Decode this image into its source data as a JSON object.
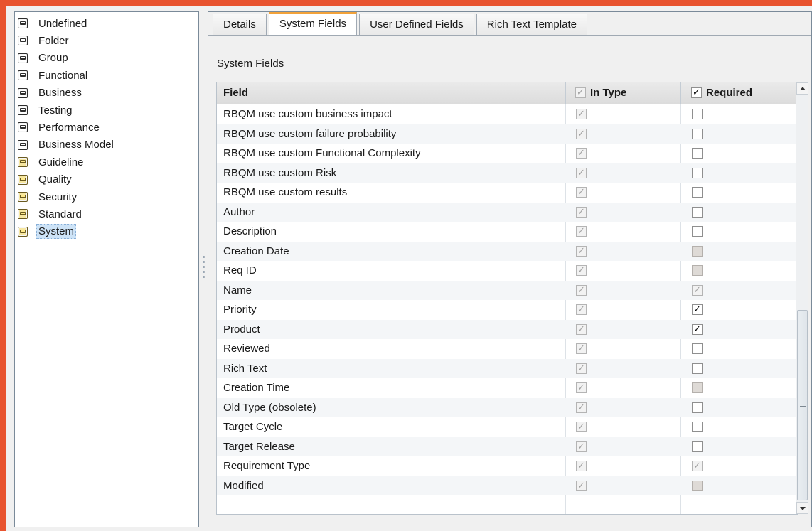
{
  "tree": {
    "items": [
      {
        "label": "Undefined",
        "icon": "req-type-icon"
      },
      {
        "label": "Folder",
        "icon": "req-type-icon"
      },
      {
        "label": "Group",
        "icon": "req-type-icon"
      },
      {
        "label": "Functional",
        "icon": "req-type-icon"
      },
      {
        "label": "Business",
        "icon": "req-type-icon"
      },
      {
        "label": "Testing",
        "icon": "req-type-icon"
      },
      {
        "label": "Performance",
        "icon": "req-type-icon"
      },
      {
        "label": "Business Model",
        "icon": "req-type-icon"
      },
      {
        "label": "Guideline",
        "icon": "req-type-yellow-icon"
      },
      {
        "label": "Quality",
        "icon": "req-type-yellow-icon"
      },
      {
        "label": "Security",
        "icon": "req-type-yellow-icon"
      },
      {
        "label": "Standard",
        "icon": "req-type-yellow-icon"
      },
      {
        "label": "System",
        "icon": "req-type-yellow-icon",
        "selected": true
      }
    ]
  },
  "tabs": [
    {
      "label": "Details",
      "active": false
    },
    {
      "label": "System Fields",
      "active": true
    },
    {
      "label": "User Defined Fields",
      "active": false
    },
    {
      "label": "Rich Text Template",
      "active": false
    }
  ],
  "group_title": "System Fields",
  "grid": {
    "headers": {
      "field": "Field",
      "in_type": "In Type",
      "required": "Required"
    },
    "rows": [
      {
        "field": "RBQM use custom business impact",
        "in_type": "checked-readonly",
        "required": "unchecked"
      },
      {
        "field": "RBQM use custom failure probability",
        "in_type": "checked-readonly",
        "required": "unchecked"
      },
      {
        "field": "RBQM use custom Functional Complexity",
        "in_type": "checked-readonly",
        "required": "unchecked"
      },
      {
        "field": "RBQM use custom Risk",
        "in_type": "checked-readonly",
        "required": "unchecked"
      },
      {
        "field": "RBQM use custom results",
        "in_type": "checked-readonly",
        "required": "unchecked"
      },
      {
        "field": "Author",
        "in_type": "checked-readonly",
        "required": "unchecked"
      },
      {
        "field": "Description",
        "in_type": "checked-readonly",
        "required": "unchecked"
      },
      {
        "field": "Creation Date",
        "in_type": "checked-readonly",
        "required": "disabled"
      },
      {
        "field": "Req ID",
        "in_type": "checked-readonly",
        "required": "disabled"
      },
      {
        "field": "Name",
        "in_type": "checked-readonly",
        "required": "checked-readonly"
      },
      {
        "field": "Priority",
        "in_type": "checked-readonly",
        "required": "checked"
      },
      {
        "field": "Product",
        "in_type": "checked-readonly",
        "required": "checked"
      },
      {
        "field": "Reviewed",
        "in_type": "checked-readonly",
        "required": "unchecked"
      },
      {
        "field": "Rich Text",
        "in_type": "checked-readonly",
        "required": "unchecked"
      },
      {
        "field": "Creation Time",
        "in_type": "checked-readonly",
        "required": "disabled"
      },
      {
        "field": "Old Type (obsolete)",
        "in_type": "checked-readonly",
        "required": "unchecked"
      },
      {
        "field": "Target Cycle",
        "in_type": "checked-readonly",
        "required": "unchecked"
      },
      {
        "field": "Target Release",
        "in_type": "checked-readonly",
        "required": "unchecked"
      },
      {
        "field": "Requirement Type",
        "in_type": "checked-readonly",
        "required": "checked-readonly"
      },
      {
        "field": "Modified",
        "in_type": "checked-readonly",
        "required": "disabled"
      }
    ]
  },
  "colors": {
    "window_border": "#e8532e",
    "active_tab_accent": "#f2a23a",
    "selection": "#cde3f7"
  }
}
